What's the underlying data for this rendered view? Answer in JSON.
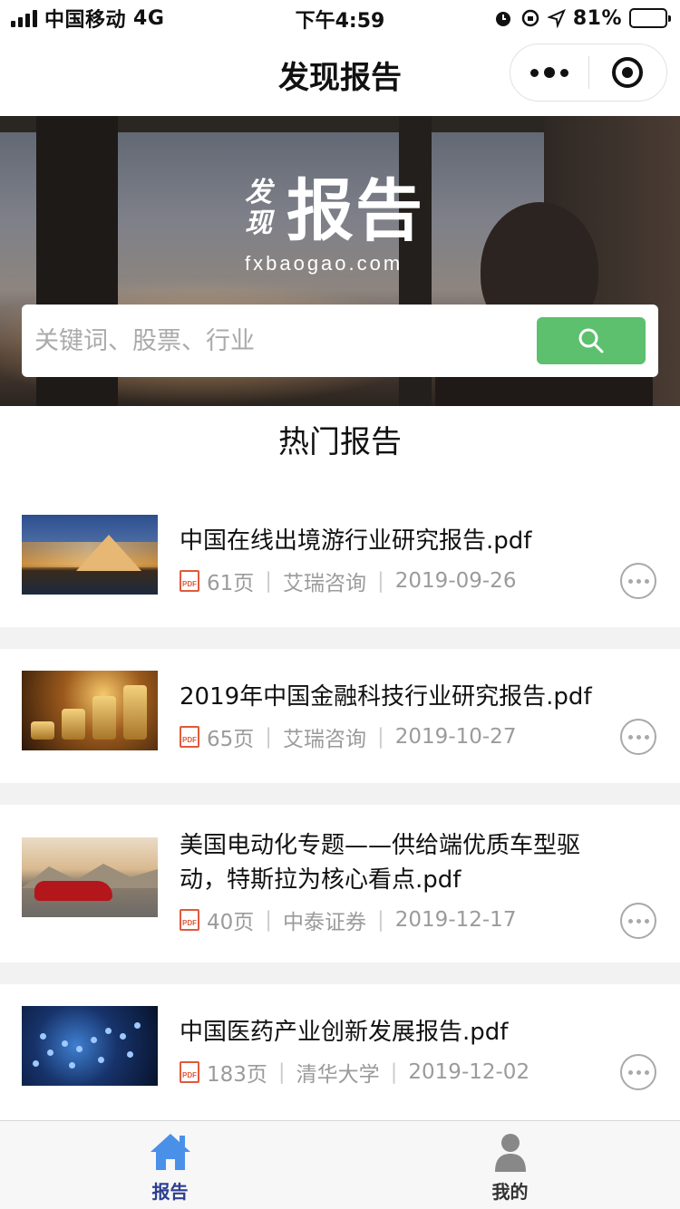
{
  "status_bar": {
    "carrier": "中国移动",
    "network": "4G",
    "time": "下午4:59",
    "battery_percent": "81%",
    "battery_level": 0.81
  },
  "nav": {
    "title": "发现报告"
  },
  "banner": {
    "logo_small": "发现",
    "logo_big": "报告",
    "logo_domain": "fxbaogao.com"
  },
  "search": {
    "placeholder": "关键词、股票、行业",
    "button_icon": "search-icon",
    "button_color": "#5cc06e"
  },
  "section": {
    "title": "热门报告"
  },
  "reports": [
    {
      "title": "中国在线出境游行业研究报告.pdf",
      "pages": "61页",
      "source": "艾瑞咨询",
      "date": "2019-09-26",
      "thumb": "louvre-pyramid-image"
    },
    {
      "title": "2019年中国金融科技行业研究报告.pdf",
      "pages": "65页",
      "source": "艾瑞咨询",
      "date": "2019-10-27",
      "thumb": "gold-coins-image"
    },
    {
      "title": "美国电动化专题——供给端优质车型驱动，特斯拉为核心看点.pdf",
      "pages": "40页",
      "source": "中泰证券",
      "date": "2019-12-17",
      "thumb": "red-car-image"
    },
    {
      "title": "中国医药产业创新发展报告.pdf",
      "pages": "183页",
      "source": "清华大学",
      "date": "2019-12-02",
      "thumb": "dna-helix-image"
    }
  ],
  "pdf_badge": "PDF",
  "tabs": [
    {
      "label": "报告",
      "icon": "home-icon",
      "active": true
    },
    {
      "label": "我的",
      "icon": "user-icon",
      "active": false
    }
  ],
  "colors": {
    "accent_green": "#5cc06e",
    "tab_active": "#2d3e8f",
    "pdf_red": "#e0593b",
    "meta_gray": "#9b9b9b"
  }
}
